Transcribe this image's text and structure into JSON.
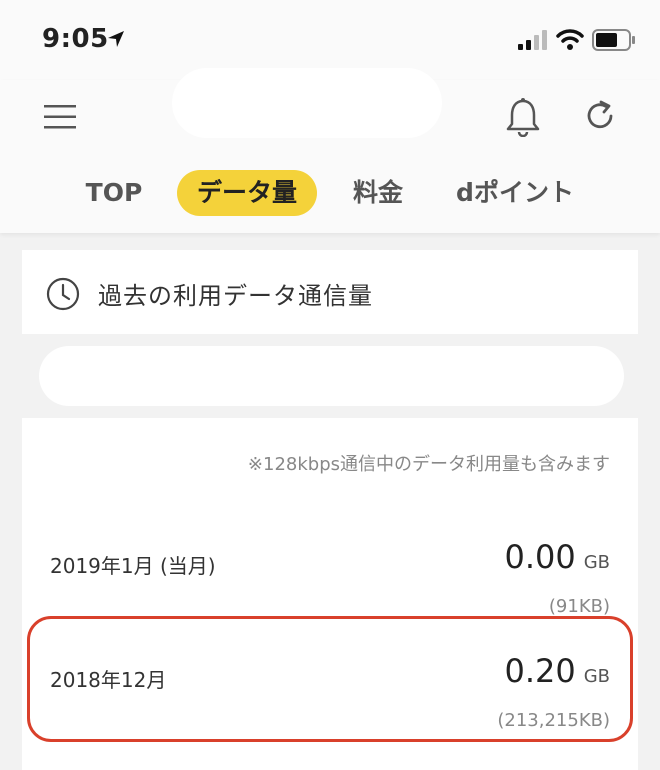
{
  "status_bar": {
    "time": "9:05"
  },
  "header": {
    "tabs": [
      {
        "label": "TOP",
        "active": false
      },
      {
        "label": "データ量",
        "active": true
      },
      {
        "label": "料金",
        "active": false
      },
      {
        "label": "dポイント",
        "active": false
      }
    ]
  },
  "card": {
    "title": "過去の利用データ通信量",
    "note": "※128kbps通信中のデータ利用量も含みます",
    "rows": [
      {
        "month": "2019年1月 (当月)",
        "amount": "0.00",
        "unit": "GB",
        "bytes": "(91KB)"
      },
      {
        "month": "2018年12月",
        "amount": "0.20",
        "unit": "GB",
        "bytes": "(213,215KB)",
        "highlighted": true
      }
    ]
  },
  "colors": {
    "accent": "#f4d23a",
    "highlight": "#d9402b",
    "background": "#f2f2f2"
  }
}
